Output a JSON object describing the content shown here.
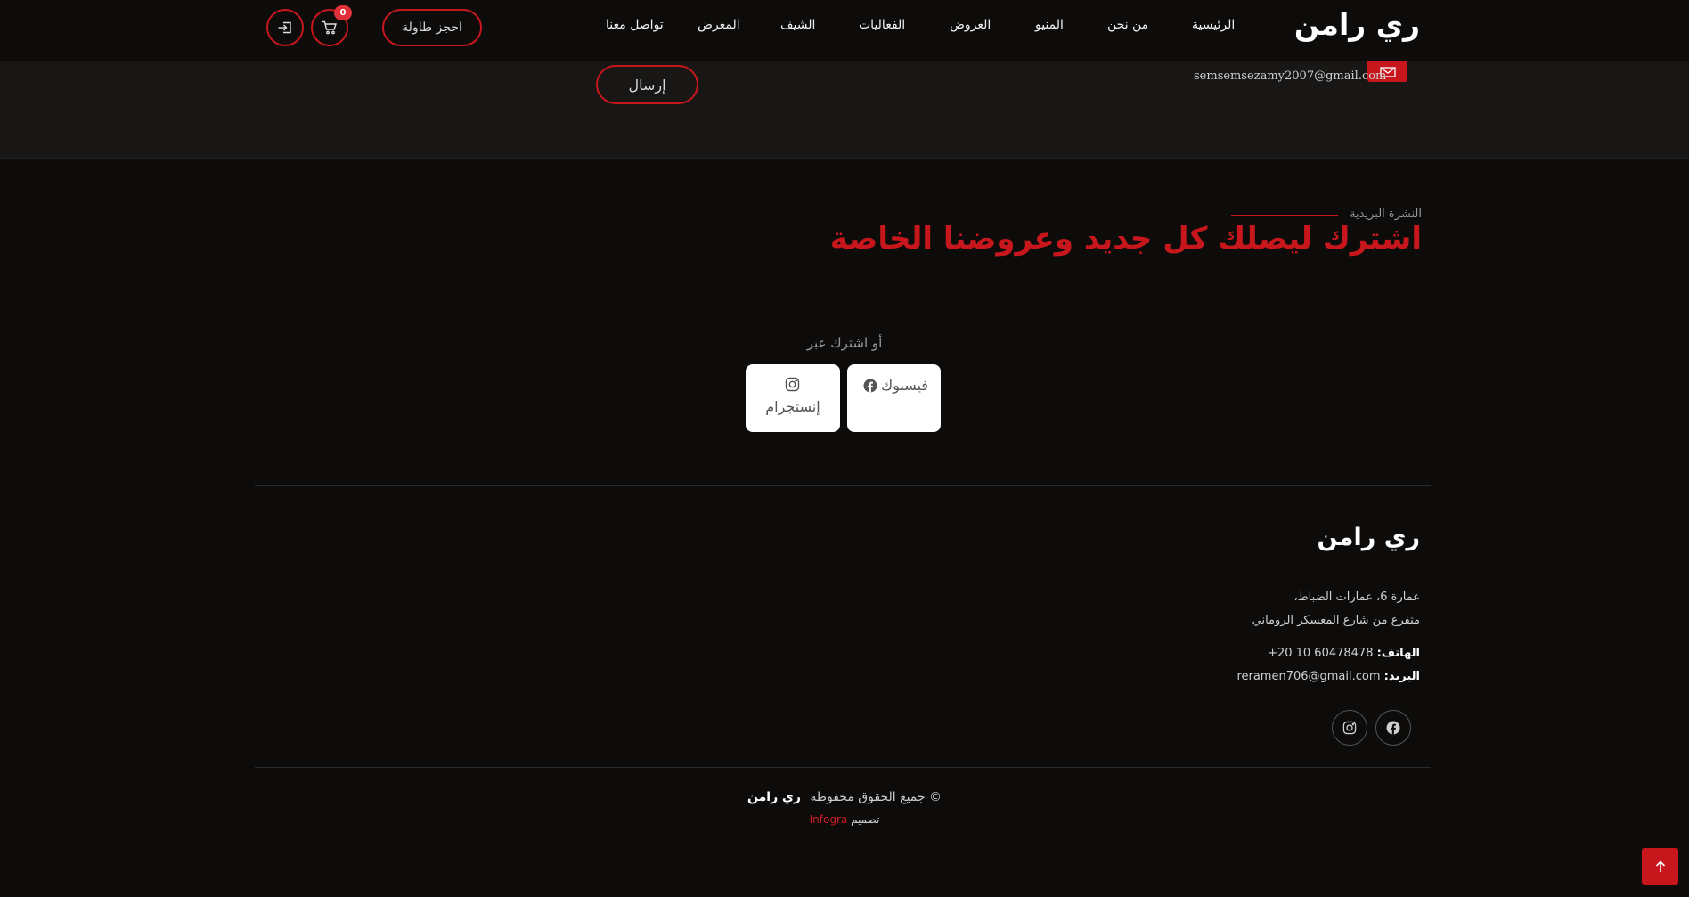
{
  "header": {
    "brand": "ري رامن",
    "nav": [
      "الرئيسية",
      "من نحن",
      "المنيو",
      "العروض",
      "الفعاليات",
      "الشيف",
      "المعرض",
      "تواصل معنا"
    ],
    "reserve_label": "احجز طاولة",
    "cart_count": "0",
    "icons": {
      "cart": "cart-icon",
      "login": "login-icon"
    }
  },
  "contact": {
    "email": "semsemsezamy2007@gmail.com",
    "send_label": "إرسال",
    "icon": "envelope-icon"
  },
  "newsletter": {
    "eyebrow": "النشرة البريدية",
    "title": "اشترك ليصلك كل جديد وعروضنا الخاصة",
    "or_subscribe": "أو اشترك عبر",
    "facebook_label": "فيسبوك",
    "instagram_label": "إنستجرام"
  },
  "footer": {
    "brand": "ري رامن",
    "address_line1": "عمارة 6، عمارات الضباط،",
    "address_line2": "متفرع من شارع المعسكر الروماني",
    "phone_label": "الهاتف:",
    "phone": "+20 10 60478478",
    "email_label": "البريد:",
    "email": "reramen706@gmail.com",
    "copyright_text": "© جميع الحقوق محفوظة",
    "copyright_name": "ري رامن",
    "designed_by": "تصميم",
    "designer": "Infogra"
  },
  "colors": {
    "accent": "#c8161d",
    "background": "#0d0c0b",
    "strip": "#181715"
  }
}
